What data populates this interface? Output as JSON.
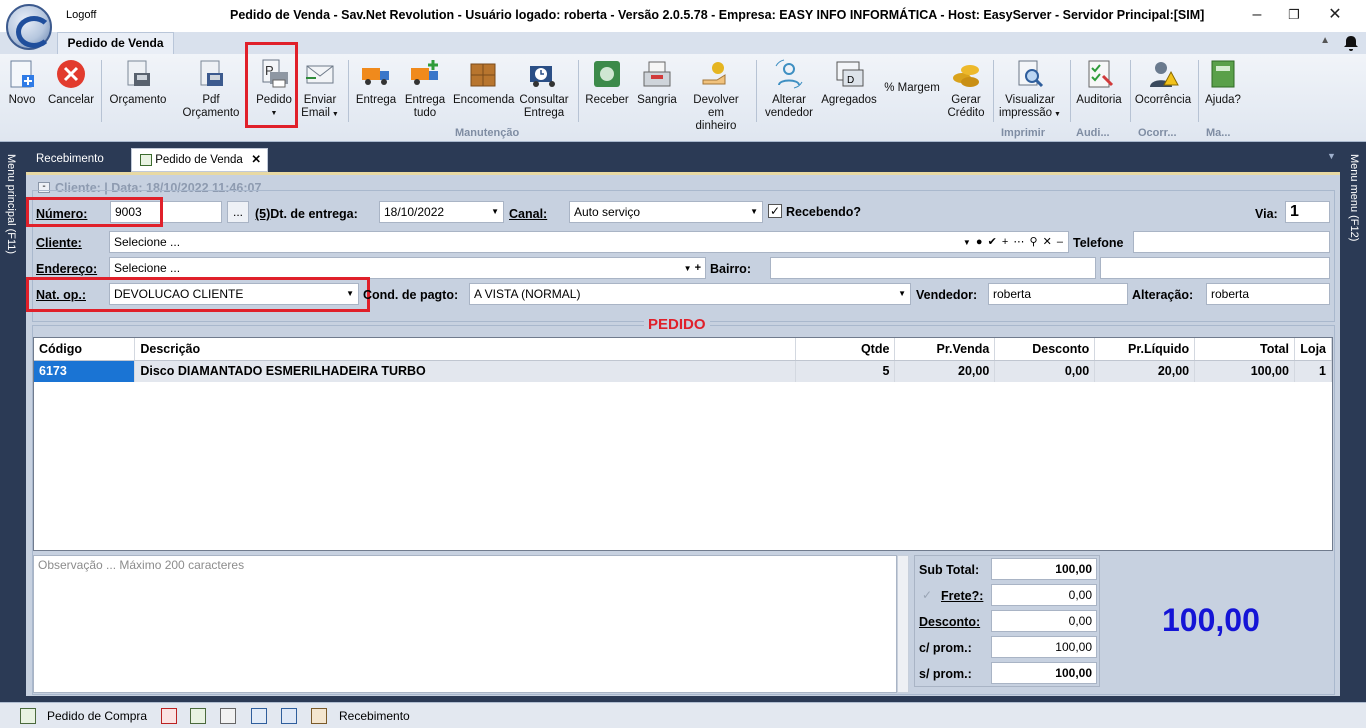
{
  "window": {
    "logoff": "Logoff",
    "title": "Pedido de Venda - Sav.Net Revolution - Usuário logado: roberta - Versão 2.0.5.78 - Empresa: EASY INFO INFORMÁTICA - Host: EasyServer - Servidor Principal:[SIM]"
  },
  "ribbon": {
    "tab": "Pedido de Venda",
    "buttons": {
      "novo": "Novo",
      "cancelar": "Cancelar",
      "orcamento": "Orçamento",
      "pdf_orcamento": "Pdf Orçamento",
      "pedido": "Pedido",
      "enviar_email_1": "Enviar",
      "enviar_email_2": "Email",
      "entrega": "Entrega",
      "entrega_tudo_1": "Entrega",
      "entrega_tudo_2": "tudo",
      "encomenda": "Encomenda",
      "consultar_entrega_1": "Consultar",
      "consultar_entrega_2": "Entrega",
      "receber": "Receber",
      "sangria": "Sangria",
      "devolver_1": "Devolver em",
      "devolver_2": "dinheiro",
      "alterar_vendedor_1": "Alterar",
      "alterar_vendedor_2": "vendedor",
      "agregados": "Agregados",
      "margem": "% Margem",
      "gerar_credito_1": "Gerar",
      "gerar_credito_2": "Crédito",
      "visualizar_1": "Visualizar",
      "visualizar_2": "impressão",
      "auditoria": "Auditoria",
      "ocorrencia": "Ocorrência",
      "ajuda": "Ajuda?"
    },
    "groups": {
      "manutencao": "Manutenção",
      "imprimir": "Imprimir",
      "audi": "Audi...",
      "ocorr": "Ocorr...",
      "ma": "Ma..."
    }
  },
  "side": {
    "left": "Menu principal (F11)",
    "right": "Menu menu (F12)"
  },
  "doc_tabs": {
    "recebimento": "Recebimento",
    "pedido_venda": "Pedido de Venda"
  },
  "form": {
    "cliente_header": "Cliente:  | Data: 18/10/2022 11:46:07",
    "numero_label": "Número:",
    "numero_value": "9003",
    "dots_button": "...",
    "dt_entrega_prefix": "(5)",
    "dt_entrega_label": "Dt. de entrega:",
    "dt_entrega_value": "18/10/2022",
    "canal_label": "Canal:",
    "canal_value": "Auto serviço",
    "recebendo_label": "Recebendo?",
    "via_label": "Via:",
    "via_value": "1",
    "cliente_label": "Cliente:",
    "cliente_value": "Selecione ...",
    "telefone_label": "Telefone",
    "endereco_label": "Endereço:",
    "endereco_value": "Selecione ...",
    "bairro_label": "Bairro:",
    "natop_label": "Nat. op.:",
    "natop_value": "DEVOLUCAO CLIENTE",
    "cond_label": "Cond. de pagto:",
    "cond_value": "A VISTA (NORMAL)",
    "vendedor_label": "Vendedor:",
    "vendedor_value": "roberta",
    "alteracao_label": "Alteração:",
    "alteracao_value": "roberta"
  },
  "pedido_title": "PEDIDO",
  "grid": {
    "headers": {
      "codigo": "Código",
      "descricao": "Descrição",
      "qtde": "Qtde",
      "prvenda": "Pr.Venda",
      "desconto": "Desconto",
      "prliquido": "Pr.Líquido",
      "total": "Total",
      "loja": "Loja"
    },
    "rows": [
      {
        "codigo": "6173",
        "descricao": "Disco DIAMANTADO ESMERILHADEIRA TURBO",
        "qtde": "5",
        "prvenda": "20,00",
        "desconto": "0,00",
        "prliquido": "20,00",
        "total": "100,00",
        "loja": "1"
      }
    ]
  },
  "observacao_placeholder": "Observação ... Máximo 200 caracteres",
  "totals": {
    "subtotal_label": "Sub Total:",
    "subtotal_value": "100,00",
    "frete_label": "Frete?:",
    "frete_value": "0,00",
    "desconto_label": "Desconto:",
    "desconto_value": "0,00",
    "cprom_label": "c/ prom.:",
    "cprom_value": "100,00",
    "sprom_label": "s/ prom.:",
    "sprom_value": "100,00",
    "grand_total": "100,00"
  },
  "statusbar": {
    "pedido_compra": "Pedido de Compra",
    "recebimento": "Recebimento"
  }
}
